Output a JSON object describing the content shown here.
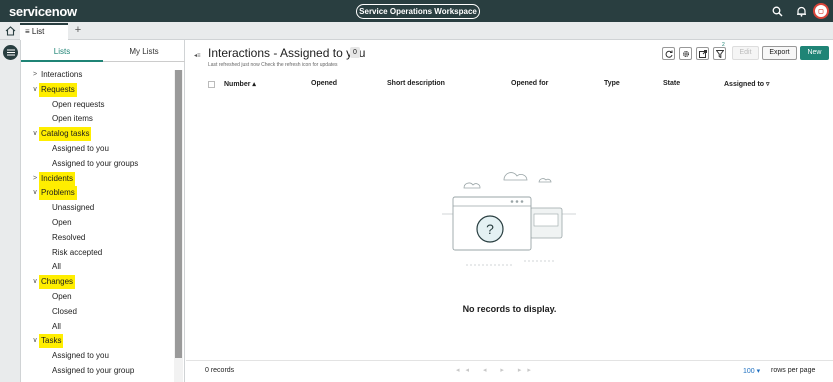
{
  "app": {
    "logo_text": "servicenow",
    "workspace_label": "Service Operations Workspace"
  },
  "tabs": {
    "list_label": "≡ List",
    "add_label": "+"
  },
  "sidebar": {
    "tabs": [
      {
        "label": "Lists",
        "active": true
      },
      {
        "label": "My Lists",
        "active": false
      }
    ],
    "tree": [
      {
        "label": "Interactions",
        "type": "group",
        "expanded": false,
        "highlighted": false
      },
      {
        "label": "Requests",
        "type": "group",
        "expanded": true,
        "highlighted": true
      },
      {
        "label": "Open requests",
        "type": "child"
      },
      {
        "label": "Open items",
        "type": "child"
      },
      {
        "label": "Catalog tasks",
        "type": "group",
        "expanded": true,
        "highlighted": true
      },
      {
        "label": "Assigned to you",
        "type": "child"
      },
      {
        "label": "Assigned to your groups",
        "type": "child"
      },
      {
        "label": "Incidents",
        "type": "group",
        "expanded": false,
        "highlighted": true
      },
      {
        "label": "Problems",
        "type": "group",
        "expanded": true,
        "highlighted": true
      },
      {
        "label": "Unassigned",
        "type": "child"
      },
      {
        "label": "Open",
        "type": "child"
      },
      {
        "label": "Resolved",
        "type": "child"
      },
      {
        "label": "Risk accepted",
        "type": "child"
      },
      {
        "label": "All",
        "type": "child"
      },
      {
        "label": "Changes",
        "type": "group",
        "expanded": true,
        "highlighted": true
      },
      {
        "label": "Open",
        "type": "child"
      },
      {
        "label": "Closed",
        "type": "child"
      },
      {
        "label": "All",
        "type": "child"
      },
      {
        "label": "Tasks",
        "type": "group",
        "expanded": true,
        "highlighted": true
      },
      {
        "label": "Assigned to you",
        "type": "child"
      },
      {
        "label": "Assigned to your group",
        "type": "child"
      }
    ]
  },
  "main": {
    "title": "Interactions - Assigned to you",
    "count": "0",
    "subtitle": "Last refreshed just now Check the refresh icon for updates",
    "toolbar": {
      "filter_count": "2",
      "edit_label": "Edit",
      "export_label": "Export",
      "new_label": "New"
    },
    "columns": [
      "Number ▴",
      "Opened",
      "Short description",
      "Opened for",
      "Type",
      "State",
      "Assigned to ▿"
    ],
    "empty_message": "No records to display.",
    "footer": {
      "records_label": "0 records",
      "pager": "◂◂ ◂ ▸ ▸▸",
      "rows_per_page_value": "100 ▾",
      "rows_per_page_label": "rows per page"
    }
  },
  "colors": {
    "topbar": "#293e40",
    "accent": "#1f8476",
    "highlight": "#ffee00"
  },
  "icons": [
    "home-icon",
    "menu-icon",
    "search-icon",
    "bell-icon",
    "refresh-icon",
    "gear-icon",
    "export-list-icon",
    "filter-icon",
    "collapse-icon"
  ]
}
